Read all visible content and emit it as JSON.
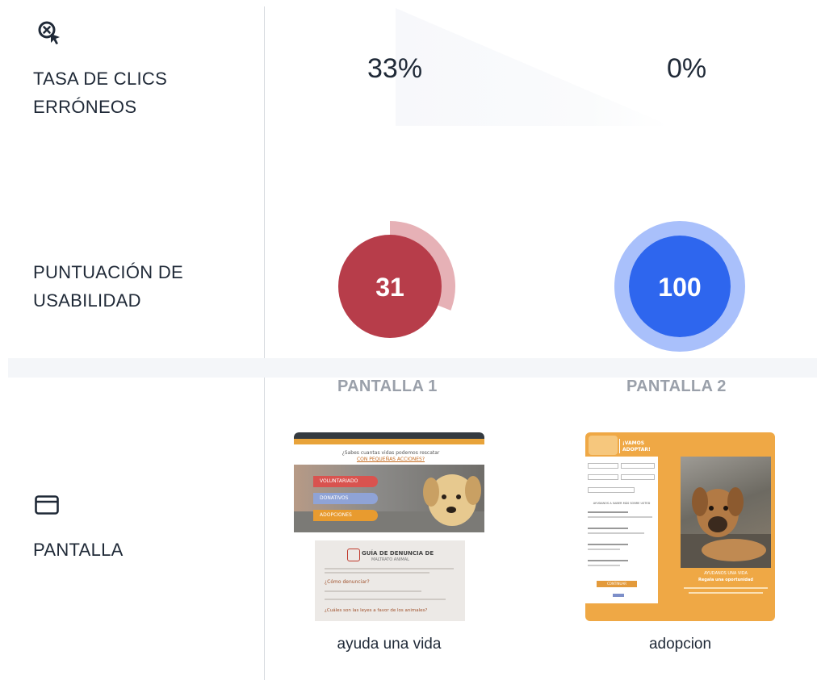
{
  "rows": {
    "misclick": {
      "icon": "misclick-cursor-icon",
      "label_line1": "TASA DE CLICS",
      "label_line2": "ERRÓNEOS"
    },
    "usability": {
      "label_line1": "PUNTUACIÓN DE",
      "label_line2": "USABILIDAD"
    },
    "screen": {
      "icon": "screen-window-icon",
      "label": "PANTALLA"
    }
  },
  "screens": [
    {
      "header": "PANTALLA 1",
      "misclick_rate": "33%",
      "usability_score": "31",
      "usability_score_value": 31,
      "score_color": "#b73d4a",
      "score_ring_color": "#e6b1b6",
      "caption": "ayuda una vida",
      "thumbnail": {
        "headline_line1": "¿Sabes cuantas vidas podemos rescatar",
        "headline_line2": "CON PEQUEÑAS ACCIONES?",
        "buttons": [
          "VOLUNTARIADO",
          "DONATIVOS",
          "ADOPCIONES"
        ],
        "guide_title": "GUÍA DE DENUNCIA DE",
        "guide_subtitle": "MALTRATO ANIMAL",
        "question1": "¿Cómo denunciar?",
        "question2": "¿Cuáles son las leyes a favor de los animales?"
      }
    },
    {
      "header": "PANTALLA 2",
      "misclick_rate": "0%",
      "usability_score": "100",
      "usability_score_value": 100,
      "score_color": "#2e66ee",
      "score_ring_color": "#a9c0fb",
      "caption": "adopcion",
      "thumbnail": {
        "header_text_line1": "¡VAMOS",
        "header_text_line2": "ADOPTAR!",
        "form_heading": "AYUDANOS A SABER MÁS SOBRE USTED",
        "submit_label": "CONTINUAR",
        "tagline_line1": "AYUDANOS UNA VIDA",
        "tagline_line2": "Regala una oportunidad"
      }
    }
  ]
}
